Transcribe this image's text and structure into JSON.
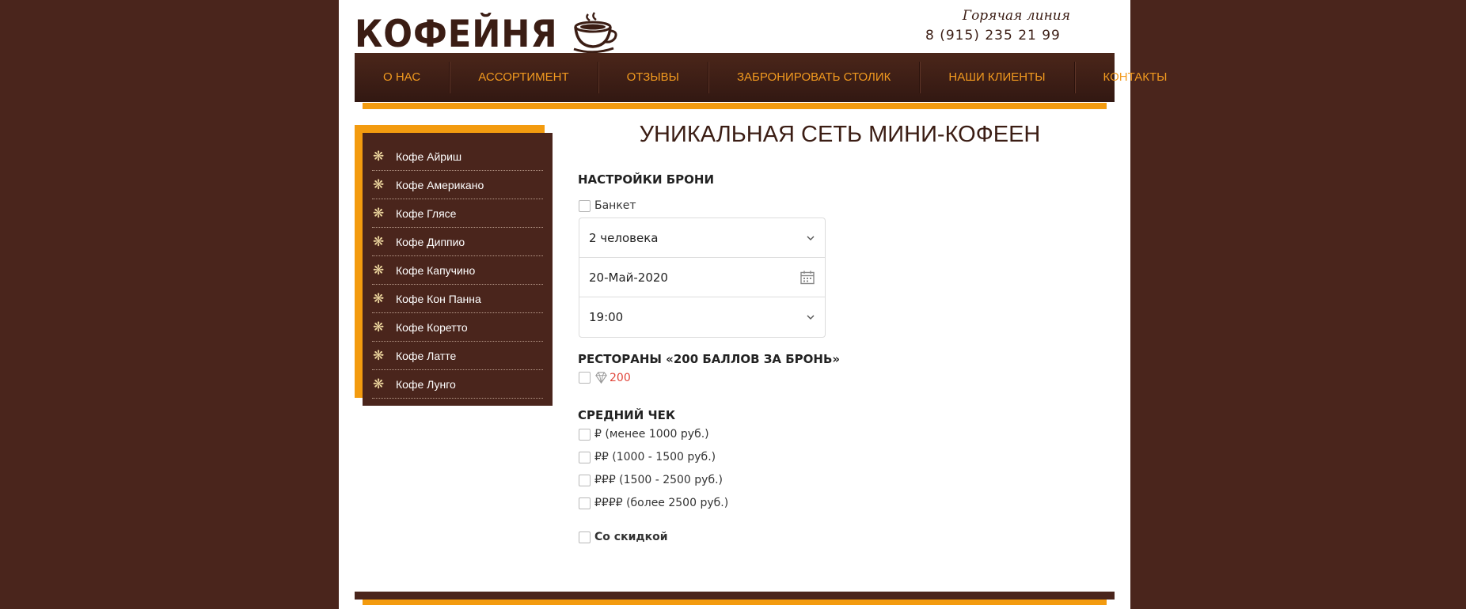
{
  "brand": {
    "logo_text": "КОФЕЙНЯ",
    "logo_icon": "coffee-cup-icon"
  },
  "hotline": {
    "label": "Горячая линия",
    "phone": "8 (915) 235 21 99"
  },
  "nav": [
    "О НАС",
    "АССОРТИМЕНТ",
    "ОТЗЫВЫ",
    "ЗАБРОНИРОВАТЬ СТОЛИК",
    "НАШИ КЛИЕНТЫ",
    "КОНТАКТЫ"
  ],
  "sidebar": {
    "icon": "flower-bullet-icon",
    "items": [
      "Кофе Айриш",
      "Кофе Американо",
      "Кофе Глясе",
      "Кофе Диппио",
      "Кофе Капучино",
      "Кофе Кон Панна",
      "Кофе Коретто",
      "Кофе Латте",
      "Кофе Лунго"
    ]
  },
  "main": {
    "title": "УНИКАЛЬНАЯ СЕТЬ МИНИ-КОФЕЕН",
    "booking": {
      "title": "НАСТРОЙКИ БРОНИ",
      "banquet_label": "Банкет",
      "guests": "2 человека",
      "date": "20-Май-2020",
      "time": "19:00"
    },
    "restaurants": {
      "title": "РЕСТОРАНЫ «200 БАЛЛОВ ЗА БРОНЬ»",
      "points": "200"
    },
    "avg_check": {
      "title": "СРЕДНИЙ ЧЕК",
      "options": [
        "₽ (менее 1000 руб.)",
        "₽₽ (1000 - 1500 руб.)",
        "₽₽₽ (1500 - 2500 руб.)",
        "₽₽₽₽ (более 2500 руб.)"
      ]
    },
    "discount_label": "Со скидкой"
  },
  "colors": {
    "background": "#4a251c",
    "accent": "#f39b0f",
    "nav_text": "#f29a1f",
    "points": "#e0453a"
  }
}
